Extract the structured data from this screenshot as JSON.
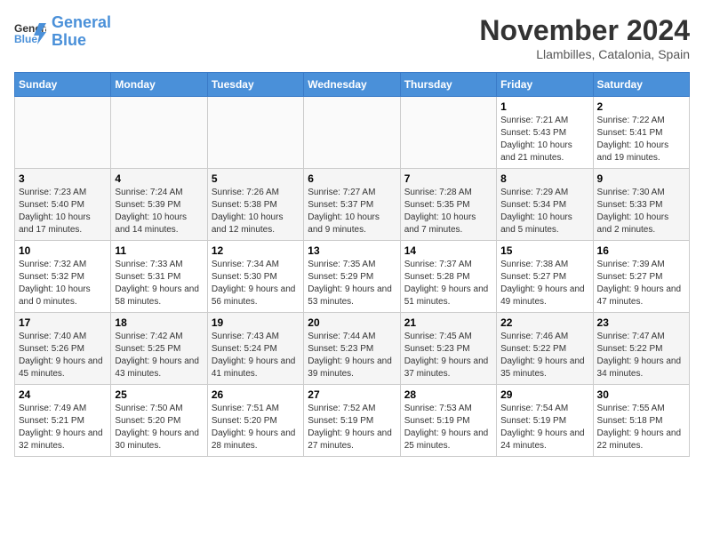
{
  "header": {
    "logo_general": "General",
    "logo_blue": "Blue",
    "month_title": "November 2024",
    "location": "Llambilles, Catalonia, Spain"
  },
  "days_of_week": [
    "Sunday",
    "Monday",
    "Tuesday",
    "Wednesday",
    "Thursday",
    "Friday",
    "Saturday"
  ],
  "weeks": [
    {
      "days": [
        {
          "num": "",
          "info": ""
        },
        {
          "num": "",
          "info": ""
        },
        {
          "num": "",
          "info": ""
        },
        {
          "num": "",
          "info": ""
        },
        {
          "num": "",
          "info": ""
        },
        {
          "num": "1",
          "info": "Sunrise: 7:21 AM\nSunset: 5:43 PM\nDaylight: 10 hours and 21 minutes."
        },
        {
          "num": "2",
          "info": "Sunrise: 7:22 AM\nSunset: 5:41 PM\nDaylight: 10 hours and 19 minutes."
        }
      ]
    },
    {
      "days": [
        {
          "num": "3",
          "info": "Sunrise: 7:23 AM\nSunset: 5:40 PM\nDaylight: 10 hours and 17 minutes."
        },
        {
          "num": "4",
          "info": "Sunrise: 7:24 AM\nSunset: 5:39 PM\nDaylight: 10 hours and 14 minutes."
        },
        {
          "num": "5",
          "info": "Sunrise: 7:26 AM\nSunset: 5:38 PM\nDaylight: 10 hours and 12 minutes."
        },
        {
          "num": "6",
          "info": "Sunrise: 7:27 AM\nSunset: 5:37 PM\nDaylight: 10 hours and 9 minutes."
        },
        {
          "num": "7",
          "info": "Sunrise: 7:28 AM\nSunset: 5:35 PM\nDaylight: 10 hours and 7 minutes."
        },
        {
          "num": "8",
          "info": "Sunrise: 7:29 AM\nSunset: 5:34 PM\nDaylight: 10 hours and 5 minutes."
        },
        {
          "num": "9",
          "info": "Sunrise: 7:30 AM\nSunset: 5:33 PM\nDaylight: 10 hours and 2 minutes."
        }
      ]
    },
    {
      "days": [
        {
          "num": "10",
          "info": "Sunrise: 7:32 AM\nSunset: 5:32 PM\nDaylight: 10 hours and 0 minutes."
        },
        {
          "num": "11",
          "info": "Sunrise: 7:33 AM\nSunset: 5:31 PM\nDaylight: 9 hours and 58 minutes."
        },
        {
          "num": "12",
          "info": "Sunrise: 7:34 AM\nSunset: 5:30 PM\nDaylight: 9 hours and 56 minutes."
        },
        {
          "num": "13",
          "info": "Sunrise: 7:35 AM\nSunset: 5:29 PM\nDaylight: 9 hours and 53 minutes."
        },
        {
          "num": "14",
          "info": "Sunrise: 7:37 AM\nSunset: 5:28 PM\nDaylight: 9 hours and 51 minutes."
        },
        {
          "num": "15",
          "info": "Sunrise: 7:38 AM\nSunset: 5:27 PM\nDaylight: 9 hours and 49 minutes."
        },
        {
          "num": "16",
          "info": "Sunrise: 7:39 AM\nSunset: 5:27 PM\nDaylight: 9 hours and 47 minutes."
        }
      ]
    },
    {
      "days": [
        {
          "num": "17",
          "info": "Sunrise: 7:40 AM\nSunset: 5:26 PM\nDaylight: 9 hours and 45 minutes."
        },
        {
          "num": "18",
          "info": "Sunrise: 7:42 AM\nSunset: 5:25 PM\nDaylight: 9 hours and 43 minutes."
        },
        {
          "num": "19",
          "info": "Sunrise: 7:43 AM\nSunset: 5:24 PM\nDaylight: 9 hours and 41 minutes."
        },
        {
          "num": "20",
          "info": "Sunrise: 7:44 AM\nSunset: 5:23 PM\nDaylight: 9 hours and 39 minutes."
        },
        {
          "num": "21",
          "info": "Sunrise: 7:45 AM\nSunset: 5:23 PM\nDaylight: 9 hours and 37 minutes."
        },
        {
          "num": "22",
          "info": "Sunrise: 7:46 AM\nSunset: 5:22 PM\nDaylight: 9 hours and 35 minutes."
        },
        {
          "num": "23",
          "info": "Sunrise: 7:47 AM\nSunset: 5:22 PM\nDaylight: 9 hours and 34 minutes."
        }
      ]
    },
    {
      "days": [
        {
          "num": "24",
          "info": "Sunrise: 7:49 AM\nSunset: 5:21 PM\nDaylight: 9 hours and 32 minutes."
        },
        {
          "num": "25",
          "info": "Sunrise: 7:50 AM\nSunset: 5:20 PM\nDaylight: 9 hours and 30 minutes."
        },
        {
          "num": "26",
          "info": "Sunrise: 7:51 AM\nSunset: 5:20 PM\nDaylight: 9 hours and 28 minutes."
        },
        {
          "num": "27",
          "info": "Sunrise: 7:52 AM\nSunset: 5:19 PM\nDaylight: 9 hours and 27 minutes."
        },
        {
          "num": "28",
          "info": "Sunrise: 7:53 AM\nSunset: 5:19 PM\nDaylight: 9 hours and 25 minutes."
        },
        {
          "num": "29",
          "info": "Sunrise: 7:54 AM\nSunset: 5:19 PM\nDaylight: 9 hours and 24 minutes."
        },
        {
          "num": "30",
          "info": "Sunrise: 7:55 AM\nSunset: 5:18 PM\nDaylight: 9 hours and 22 minutes."
        }
      ]
    }
  ]
}
